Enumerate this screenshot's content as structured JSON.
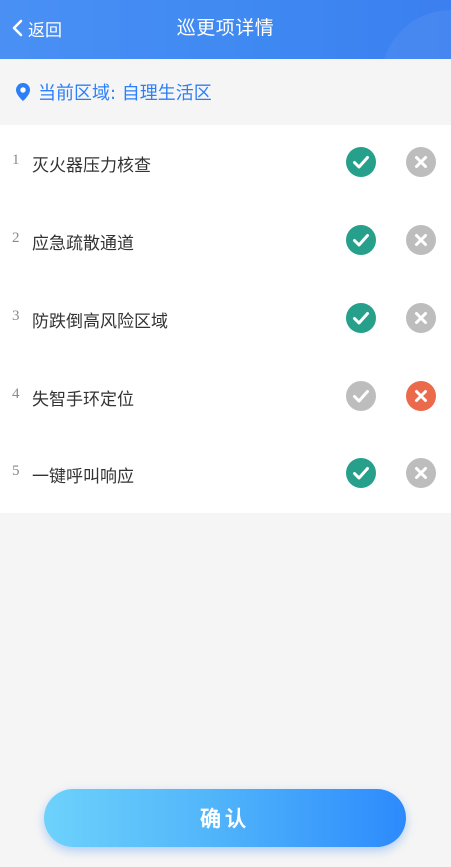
{
  "header": {
    "back_label": "返回",
    "title": "巡更项详情"
  },
  "area": {
    "icon": "location-pin-icon",
    "text": "当前区域: 自理生活区"
  },
  "items": [
    {
      "num": "1",
      "label": "灭火器压力核查",
      "status": "pass"
    },
    {
      "num": "2",
      "label": "应急疏散通道",
      "status": "pass"
    },
    {
      "num": "3",
      "label": "防跌倒高风险区域",
      "status": "pass"
    },
    {
      "num": "4",
      "label": "失智手环定位",
      "status": "fail"
    },
    {
      "num": "5",
      "label": "一键呼叫响应",
      "status": "pass"
    }
  ],
  "colors": {
    "pass_active": "#26a08a",
    "fail_active": "#ec6a4c",
    "inactive": "#bdbdbd",
    "accent": "#2d7ff9"
  },
  "confirm": {
    "label": "确认"
  }
}
